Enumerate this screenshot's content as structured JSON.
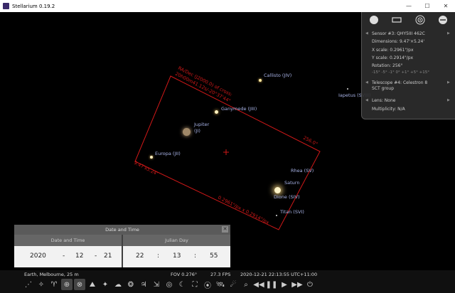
{
  "window": {
    "title": "Stellarium 0.19.2",
    "controls": [
      "—",
      "☐",
      "✕"
    ]
  },
  "sky": {
    "objects": {
      "callisto": "Callisto (JIV)",
      "ganymede": "Ganymede (JIII)",
      "jupiter_line1": "Jupiter",
      "jupiter_line2": "(JI)",
      "europa": "Europa (JII)",
      "iapetus": "Iapetus (SVIII)",
      "rhea": "Rhea (SV)",
      "saturn": "Saturn",
      "dione": "Dione (SIV)",
      "titan": "Titan (SVI)"
    },
    "ccd_frame": {
      "radec_label_1": "RA/Dec (J2000.0) of cross:",
      "radec_label_2": "20h00m41.12s/-20°37'44\"",
      "rotation_label": "256.0°",
      "size_label": "9.47'x5.24'",
      "scale_label": "0.2961\"/px x 0.2914\"/px"
    }
  },
  "ocular_panel": {
    "sensor": "Sensor #3: QHY5III 462C",
    "dimensions": "Dimensions: 9.47'×5.24'",
    "x_scale": "X scale: 0.2961\"/px",
    "y_scale": "Y scale: 0.2914\"/px",
    "rotation": "Rotation: 256°",
    "rotation_steps": "-15° -5° -1° 0° +1° +5° +15°",
    "telescope_line1": "Telescope #4: Celestron 8",
    "telescope_line2": "SCT group",
    "lens": "Lens: None",
    "multiplicity": "Multiplicity: N/A"
  },
  "datetime_panel": {
    "title": "Date and Time",
    "close": "✕",
    "date_tab": "Date and Time",
    "jd_tab": "Julian Day",
    "year": "2020",
    "month": "12",
    "day": "21",
    "hour": "22",
    "minute": "13",
    "second": "55",
    "dash": "-",
    "colon": ":"
  },
  "status_bar": {
    "location": "Earth, Melbourne, 25 m",
    "fov": "FOV 0.276°",
    "fps": "27.3 FPS",
    "datetime": "2020-12-21 22:13:55 UTC+11:00"
  },
  "colors": {
    "frame": "#d01818",
    "label": "#a9b4e8",
    "panel_bg": "#2d2d2d"
  }
}
